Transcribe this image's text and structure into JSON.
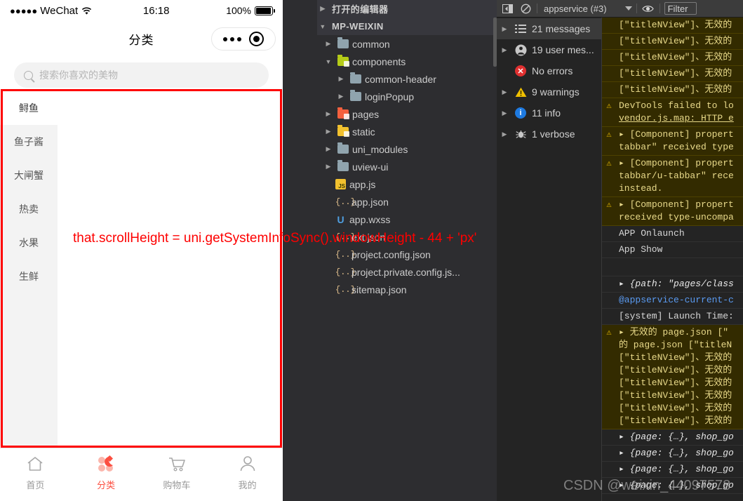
{
  "simulator": {
    "status_bar": {
      "signal_dots": "●●●●●",
      "carrier": "WeChat",
      "time": "16:18",
      "battery_percent": "100%"
    },
    "nav": {
      "title": "分类",
      "capsule_more": "more-dots",
      "capsule_target": "target-circle"
    },
    "search": {
      "placeholder": "搜索你喜欢的美物",
      "value": "",
      "icon": "search-icon"
    },
    "categories": [
      {
        "label": "鲟鱼",
        "active": true
      },
      {
        "label": "鱼子酱",
        "active": false
      },
      {
        "label": "大闸蟹",
        "active": false
      },
      {
        "label": "热卖",
        "active": false
      },
      {
        "label": "水果",
        "active": false
      },
      {
        "label": "生鲜",
        "active": false
      }
    ],
    "tabbar": [
      {
        "label": "首页",
        "icon": "home-icon",
        "active": false
      },
      {
        "label": "分类",
        "icon": "category-icon",
        "active": true
      },
      {
        "label": "购物车",
        "icon": "cart-icon",
        "active": false
      },
      {
        "label": "我的",
        "icon": "user-icon",
        "active": false
      }
    ]
  },
  "annotation": {
    "text": "that.scrollHeight = uni.getSystemInfoSync().windowHeight - 44 + 'px'",
    "color": "#fe0000",
    "frame_color": "#fe0000"
  },
  "explorer": {
    "sections": [
      {
        "label": "打开的编辑器",
        "expanded": false,
        "type": "section"
      },
      {
        "label": "MP-WEIXIN",
        "expanded": true,
        "type": "section"
      }
    ],
    "tree": [
      {
        "label": "common",
        "type": "folder",
        "color": "#90a4ae",
        "indent": 1,
        "expanded": false
      },
      {
        "label": "components",
        "type": "folder",
        "color": "#b5cc18",
        "indent": 1,
        "expanded": true,
        "badge": true
      },
      {
        "label": "common-header",
        "type": "folder",
        "color": "#90a4ae",
        "indent": 2,
        "expanded": false
      },
      {
        "label": "loginPopup",
        "type": "folder",
        "color": "#90a4ae",
        "indent": 2,
        "expanded": false
      },
      {
        "label": "pages",
        "type": "folder",
        "color": "#f4603e",
        "indent": 1,
        "expanded": false,
        "badge": true
      },
      {
        "label": "static",
        "type": "folder",
        "color": "#f2c12e",
        "indent": 1,
        "expanded": false,
        "badge": true
      },
      {
        "label": "uni_modules",
        "type": "folder",
        "color": "#90a4ae",
        "indent": 1,
        "expanded": false
      },
      {
        "label": "uview-ui",
        "type": "folder",
        "color": "#90a4ae",
        "indent": 1,
        "expanded": false
      },
      {
        "label": "app.js",
        "type": "js",
        "indent": 2,
        "icon_text": "JS"
      },
      {
        "label": "app.json",
        "type": "json",
        "indent": 2,
        "icon_text": "{..}"
      },
      {
        "label": "app.wxss",
        "type": "wxss",
        "indent": 2,
        "icon_text": "U"
      },
      {
        "label": "ext.json",
        "type": "json",
        "indent": 2,
        "icon_text": "{..}"
      },
      {
        "label": "project.config.json",
        "type": "json",
        "indent": 2,
        "icon_text": "{..}"
      },
      {
        "label": "project.private.config.js...",
        "type": "json",
        "indent": 2,
        "icon_text": "{..}"
      },
      {
        "label": "sitemap.json",
        "type": "json",
        "indent": 2,
        "icon_text": "{..}"
      }
    ]
  },
  "devtools": {
    "toolbar": {
      "sidebar_toggle_icon": "panel-toggle-icon",
      "clear_console_icon": "clear-console-icon",
      "context_selector": "appservice (#3)",
      "eye_icon": "eye-icon",
      "filter_placeholder": "Filter"
    },
    "sidebar": [
      {
        "label": "21 messages",
        "icon": "list-icon",
        "selected": true,
        "expandable": true
      },
      {
        "label": "19 user mes...",
        "icon": "user-icon",
        "selected": false,
        "expandable": true
      },
      {
        "label": "No errors",
        "icon": "error-icon",
        "selected": false,
        "expandable": false
      },
      {
        "label": "9 warnings",
        "icon": "warning-icon",
        "selected": false,
        "expandable": true
      },
      {
        "label": "11 info",
        "icon": "info-icon",
        "selected": false,
        "expandable": true
      },
      {
        "label": "1 verbose",
        "icon": "verbose-icon",
        "selected": false,
        "expandable": true
      }
    ],
    "log": [
      {
        "level": "warn",
        "icon": "",
        "lines": [
          "[\"titleNView\"]、无效的"
        ]
      },
      {
        "level": "warn",
        "icon": "",
        "lines": [
          "[\"titleNView\"]、无效的"
        ]
      },
      {
        "level": "warn",
        "icon": "",
        "lines": [
          "[\"titleNView\"]、无效的"
        ]
      },
      {
        "level": "warn",
        "icon": "",
        "lines": [
          "[\"titleNView\"]、无效的"
        ]
      },
      {
        "level": "warn",
        "icon": "",
        "lines": [
          "[\"titleNView\"]、无效的"
        ]
      },
      {
        "level": "warn",
        "icon": "warning-icon",
        "lines": [
          "DevTools failed to lo",
          "vendor.js.map: HTTP e"
        ],
        "link_line": 1
      },
      {
        "level": "warn",
        "icon": "warning-icon",
        "lines": [
          "▸ [Component] propert",
          "tabbar\" received type"
        ]
      },
      {
        "level": "warn",
        "icon": "warning-icon",
        "lines": [
          "▸ [Component] propert",
          "tabbar/u-tabbar\" rece",
          "instead."
        ]
      },
      {
        "level": "warn",
        "icon": "warning-icon",
        "lines": [
          "▸ [Component] propert",
          "received type-uncompa"
        ]
      },
      {
        "level": "plain",
        "icon": "",
        "lines": [
          "APP Onlaunch"
        ]
      },
      {
        "level": "plain",
        "icon": "",
        "lines": [
          "App Show"
        ]
      },
      {
        "level": "plain",
        "icon": "",
        "lines": [
          ""
        ]
      },
      {
        "level": "object",
        "icon": "",
        "lines": [
          "▸ {path: \"pages/class"
        ]
      },
      {
        "level": "blue",
        "icon": "",
        "lines": [
          "@appservice-current-c"
        ]
      },
      {
        "level": "plain",
        "icon": "",
        "lines": [
          "[system] Launch Time:"
        ]
      },
      {
        "level": "warn",
        "icon": "warning-icon",
        "lines": [
          "▸ 无效的 page.json [\"",
          "的 page.json [\"titleN",
          "[\"titleNView\"]、无效的",
          "[\"titleNView\"]、无效的",
          "[\"titleNView\"]、无效的",
          "[\"titleNView\"]、无效的",
          "[\"titleNView\"]、无效的",
          "[\"titleNView\"]、无效的"
        ]
      },
      {
        "level": "object",
        "icon": "",
        "lines": [
          "▸ {page: {…}, shop_go"
        ]
      },
      {
        "level": "object",
        "icon": "",
        "lines": [
          "▸ {page: {…}, shop_go"
        ]
      },
      {
        "level": "object",
        "icon": "",
        "lines": [
          "▸ {page: {…}, shop_go"
        ]
      },
      {
        "level": "object",
        "icon": "",
        "lines": [
          "▸ {page: {…}, shop_go"
        ]
      }
    ]
  },
  "watermark": {
    "text": "CSDN @weixin_44097578"
  }
}
